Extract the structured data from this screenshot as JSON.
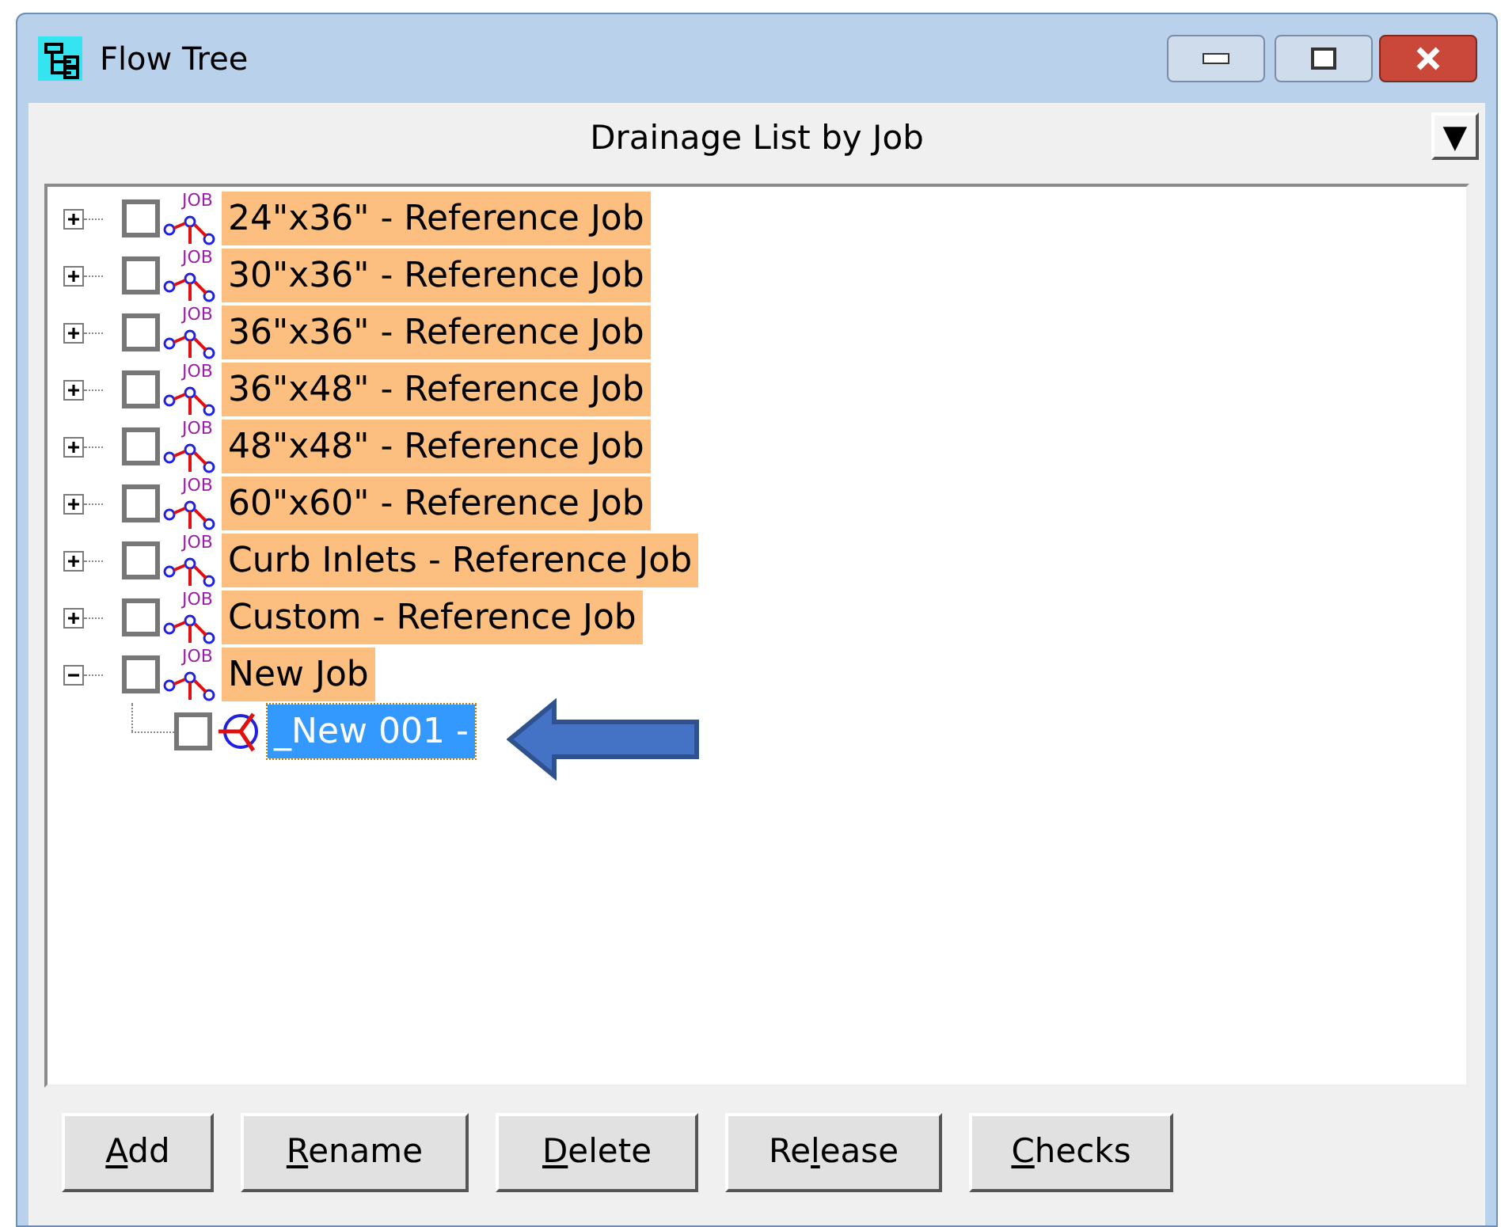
{
  "window": {
    "title": "Flow Tree"
  },
  "header": {
    "title": "Drainage List by Job",
    "dropdown": "▼"
  },
  "tree": [
    {
      "kind": "job",
      "icon_text": "JOB",
      "label": "24\"x36\" - Reference Job",
      "checked": false,
      "expanded": false,
      "highlighted": true,
      "selected": false
    },
    {
      "kind": "job",
      "icon_text": "JOB",
      "label": "30\"x36\" - Reference Job",
      "checked": false,
      "expanded": false,
      "highlighted": true,
      "selected": false
    },
    {
      "kind": "job",
      "icon_text": "JOB",
      "label": "36\"x36\" - Reference Job",
      "checked": false,
      "expanded": false,
      "highlighted": true,
      "selected": false
    },
    {
      "kind": "job",
      "icon_text": "JOB",
      "label": "36\"x48\" - Reference Job",
      "checked": false,
      "expanded": false,
      "highlighted": true,
      "selected": false
    },
    {
      "kind": "job",
      "icon_text": "JOB",
      "label": "48\"x48\" - Reference Job",
      "checked": false,
      "expanded": false,
      "highlighted": true,
      "selected": false
    },
    {
      "kind": "job",
      "icon_text": "JOB",
      "label": "60\"x60\" - Reference Job",
      "checked": false,
      "expanded": false,
      "highlighted": true,
      "selected": false
    },
    {
      "kind": "job",
      "icon_text": "JOB",
      "label": "Curb Inlets - Reference Job",
      "checked": false,
      "expanded": false,
      "highlighted": true,
      "selected": false
    },
    {
      "kind": "job",
      "icon_text": "JOB",
      "label": "Custom - Reference Job",
      "checked": false,
      "expanded": false,
      "highlighted": true,
      "selected": false
    },
    {
      "kind": "job",
      "icon_text": "JOB",
      "label": "New Job",
      "checked": false,
      "expanded": true,
      "highlighted": true,
      "selected": false,
      "children": [
        {
          "kind": "structure",
          "label": "_New 001 -",
          "checked": false,
          "selected": true
        }
      ]
    }
  ],
  "buttons": [
    {
      "key": "A",
      "suffix": "dd"
    },
    {
      "key": "R",
      "suffix": "ename"
    },
    {
      "key": "D",
      "suffix": "elete"
    },
    {
      "prefix": "Re",
      "key": "l",
      "suffix": "ease"
    },
    {
      "key": "C",
      "suffix": "hecks"
    }
  ]
}
